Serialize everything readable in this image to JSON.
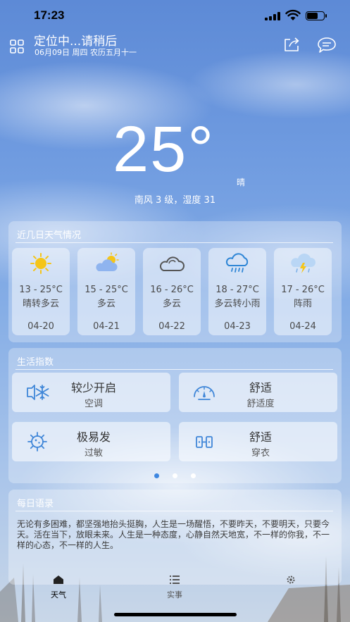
{
  "status_bar": {
    "time": "17:23"
  },
  "header": {
    "location_title": "定位中...请稍后",
    "date_line": "06月09日 周四 农历五月十一"
  },
  "current": {
    "temperature": "25°",
    "condition": "晴",
    "wind_humidity": "南风 3 级，湿度 31"
  },
  "forecast": {
    "title": "近几日天气情况",
    "days": [
      {
        "temp_range": "13 - 25°C",
        "desc": "晴转多云",
        "date": "04-20",
        "icon": "sun-icon"
      },
      {
        "temp_range": "15 - 25°C",
        "desc": "多云",
        "date": "04-21",
        "icon": "partly-cloudy-icon"
      },
      {
        "temp_range": "16 - 26°C",
        "desc": "多云",
        "date": "04-22",
        "icon": "cloud-icon"
      },
      {
        "temp_range": "18 - 27°C",
        "desc": "多云转小雨",
        "date": "04-23",
        "icon": "rain-icon"
      },
      {
        "temp_range": "17 - 26°C",
        "desc": "阵雨",
        "date": "04-24",
        "icon": "thunder-shower-icon"
      }
    ]
  },
  "life": {
    "title": "生活指数",
    "items": [
      {
        "value": "较少开启",
        "label": "空调",
        "icon": "air-conditioner-icon"
      },
      {
        "value": "舒适",
        "label": "舒适度",
        "icon": "gauge-icon"
      },
      {
        "value": "极易发",
        "label": "过敏",
        "icon": "allergy-virus-icon"
      },
      {
        "value": "舒适",
        "label": "穿衣",
        "icon": "clothing-icon"
      }
    ],
    "pager": {
      "pages": 3,
      "active": 1
    }
  },
  "quote": {
    "title": "每日语录",
    "text": "无论有多困难，都坚强地抬头挺胸，人生是一场醒悟，不要昨天，不要明天，只要今天。活在当下，放眼未来。人生是一种态度，心静自然天地宽，不一样的你我，不一样的心态，不一样的人生。"
  },
  "tabs": [
    {
      "label": "天气",
      "icon": "home-icon",
      "active": true
    },
    {
      "label": "实事",
      "icon": "list-icon",
      "active": false
    },
    {
      "label": "",
      "icon": "settings-icon",
      "active": false
    }
  ],
  "colors": {
    "accent": "#3d86e0",
    "sun": "#f5c518",
    "icon_blue": "#3f86d8"
  }
}
